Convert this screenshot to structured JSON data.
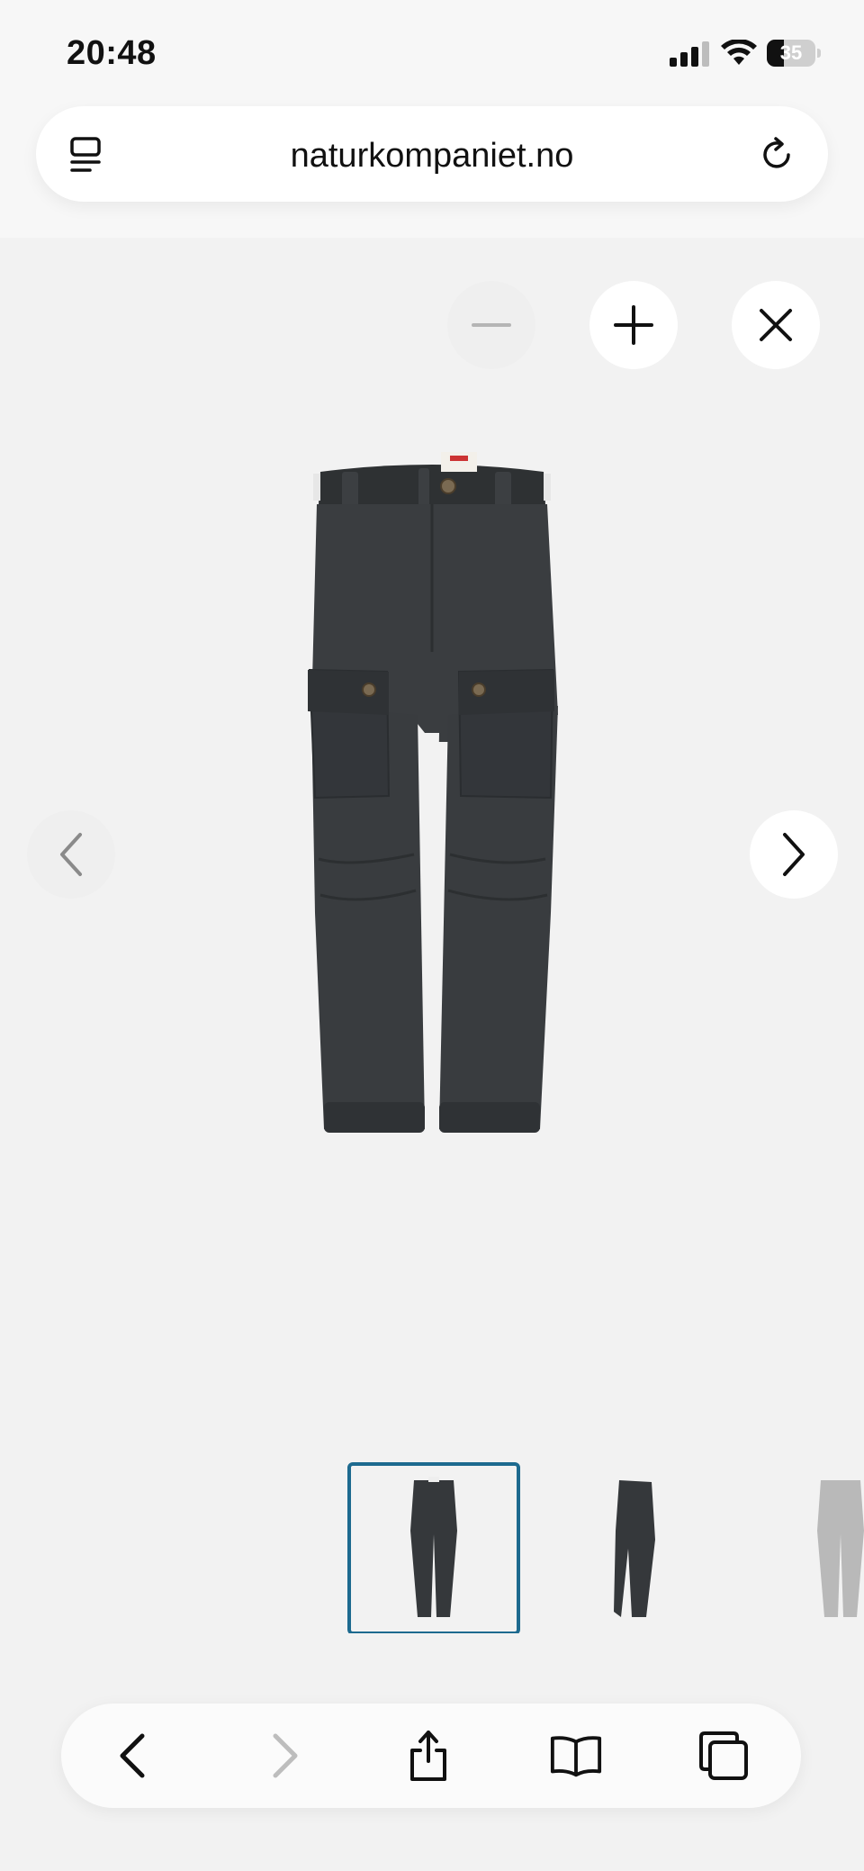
{
  "status_bar": {
    "time": "20:48",
    "battery_percent": "35",
    "battery_level": 0.35,
    "signal_bars": 3,
    "icons": [
      "signal-icon",
      "wifi-icon",
      "battery-icon"
    ]
  },
  "address_bar": {
    "url": "naturkompaniet.no",
    "left_icon": "page-menu-icon",
    "right_icon": "reload-icon"
  },
  "viewer": {
    "controls": [
      "zoom-out-icon",
      "zoom-in-icon",
      "close-icon",
      "chevron-left-icon",
      "chevron-right-icon"
    ],
    "main_image": "product-image-trousers-front",
    "thumbnails": [
      {
        "name": "trousers-front",
        "selected": true
      },
      {
        "name": "trousers-side",
        "selected": false
      },
      {
        "name": "trousers-back-faded",
        "selected": false
      }
    ],
    "accent_color": "#1d6a8f",
    "product_color": "#3a3c3e"
  },
  "toolbar": {
    "icons": [
      "back-icon",
      "forward-icon",
      "share-icon",
      "bookmarks-icon",
      "tabs-icon"
    ]
  }
}
